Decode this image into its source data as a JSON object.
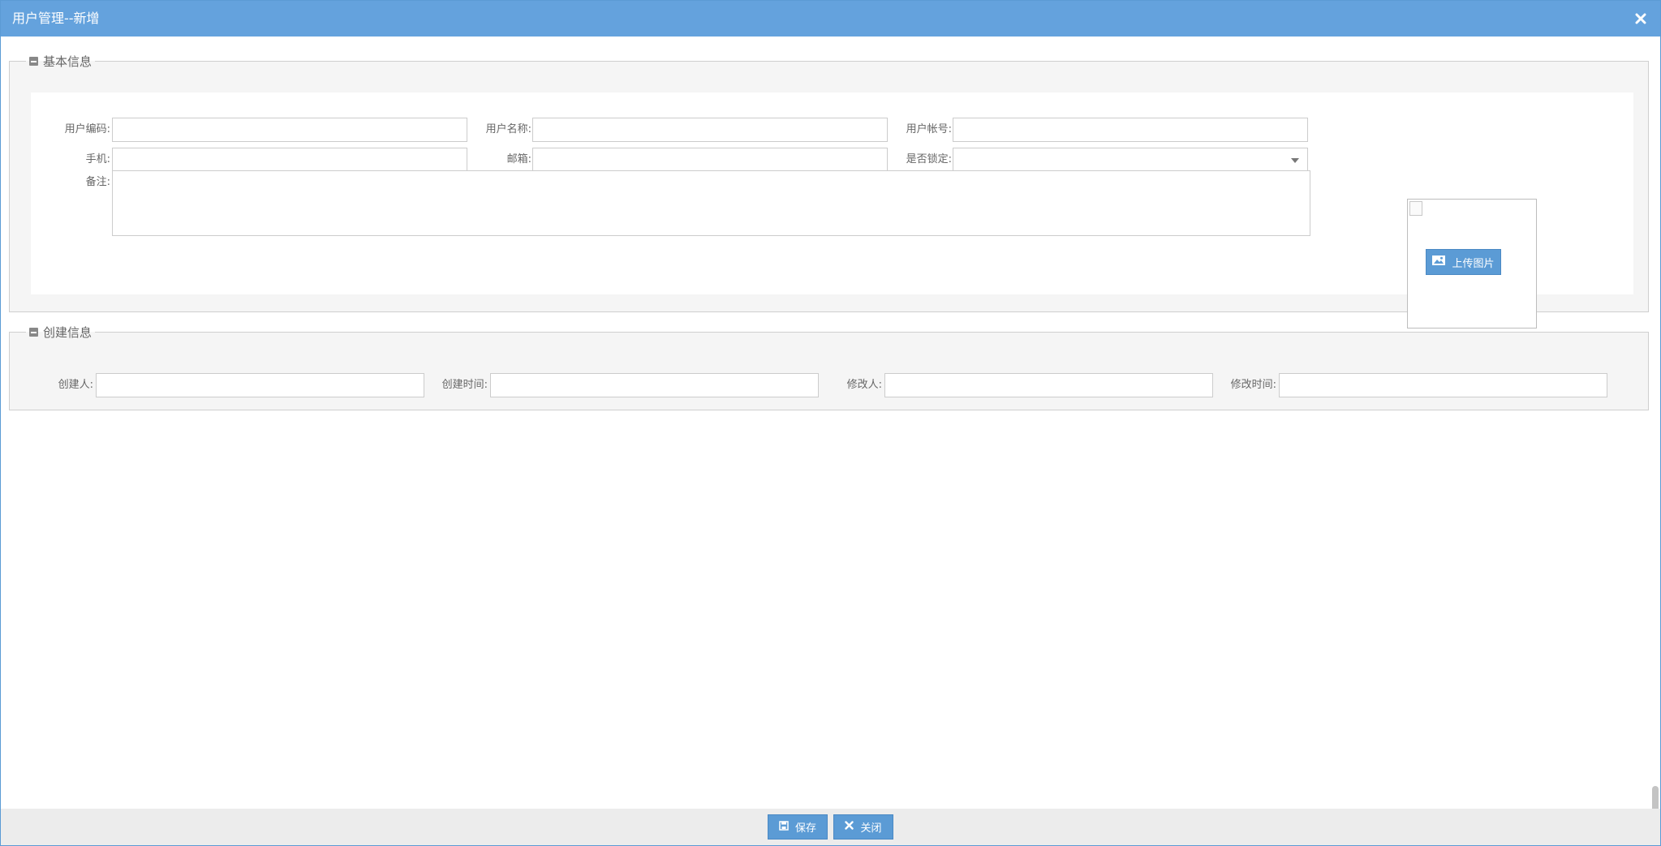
{
  "window": {
    "title": "用户管理--新增"
  },
  "basic_info": {
    "legend": "基本信息",
    "fields": {
      "user_code": {
        "label": "用户编码:",
        "value": ""
      },
      "user_name": {
        "label": "用户名称:",
        "value": ""
      },
      "user_account": {
        "label": "用户帐号:",
        "value": ""
      },
      "phone": {
        "label": "手机:",
        "value": ""
      },
      "email": {
        "label": "邮箱:",
        "value": ""
      },
      "locked": {
        "label": "是否锁定:",
        "value": ""
      },
      "remark": {
        "label": "备注:",
        "value": ""
      }
    },
    "upload_label": "上传图片"
  },
  "create_info": {
    "legend": "创建信息",
    "fields": {
      "creator": {
        "label": "创建人:",
        "value": ""
      },
      "create_time": {
        "label": "创建时间:",
        "value": ""
      },
      "modifier": {
        "label": "修改人:",
        "value": ""
      },
      "modify_time": {
        "label": "修改时间:",
        "value": ""
      }
    }
  },
  "footer": {
    "save_label": "保存",
    "close_label": "关闭"
  },
  "colors": {
    "accent": "#64a2dd",
    "button": "#5b9bd5",
    "footer_bg": "#ececec"
  }
}
